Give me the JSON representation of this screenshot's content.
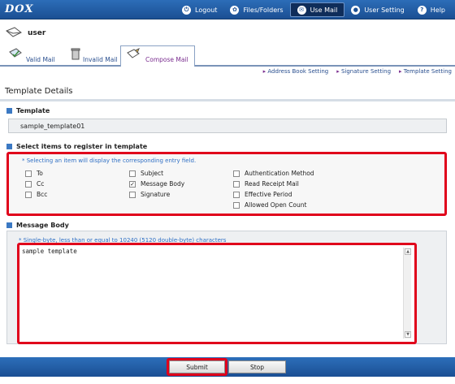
{
  "app": {
    "logo": "DOX"
  },
  "nav": [
    {
      "label": "Logout",
      "icon": "logout-icon"
    },
    {
      "label": "Files/Folders",
      "icon": "folders-icon"
    },
    {
      "label": "Use Mail",
      "icon": "mail-icon",
      "active": true
    },
    {
      "label": "User Setting",
      "icon": "user-setting-icon"
    },
    {
      "label": "Help",
      "icon": "help-icon"
    }
  ],
  "user": {
    "name": "user"
  },
  "tabs": [
    {
      "label": "Valid Mail"
    },
    {
      "label": "Invalid Mail"
    },
    {
      "label": "Compose Mail",
      "active": true
    }
  ],
  "links": [
    "Address Book Setting",
    "Signature Setting",
    "Template Setting"
  ],
  "page": {
    "title": "Template Details"
  },
  "template": {
    "section": "Template",
    "value": "sample_template01"
  },
  "select": {
    "section": "Select items to register in template",
    "hint": "* Selecting an item will display the corresponding entry field.",
    "items": [
      {
        "label": "To",
        "checked": false
      },
      {
        "label": "Cc",
        "checked": false
      },
      {
        "label": "Bcc",
        "checked": false
      },
      {
        "label": "Subject",
        "checked": false
      },
      {
        "label": "Message Body",
        "checked": true
      },
      {
        "label": "Signature",
        "checked": false
      },
      {
        "label": "Authentication Method",
        "checked": false
      },
      {
        "label": "Read Receipt Mail",
        "checked": false
      },
      {
        "label": "Effective Period",
        "checked": false
      },
      {
        "label": "Allowed Open Count",
        "checked": false
      }
    ]
  },
  "message": {
    "section": "Message Body",
    "note": "* Single-byte, less than or equal to 10240 (5120 double-byte) characters",
    "value": "sample template"
  },
  "buttons": {
    "submit": "Submit",
    "stop": "Stop"
  },
  "colors": {
    "brand": "#1b4f93",
    "highlight": "#e0001b",
    "hint": "#2f6fc4"
  }
}
